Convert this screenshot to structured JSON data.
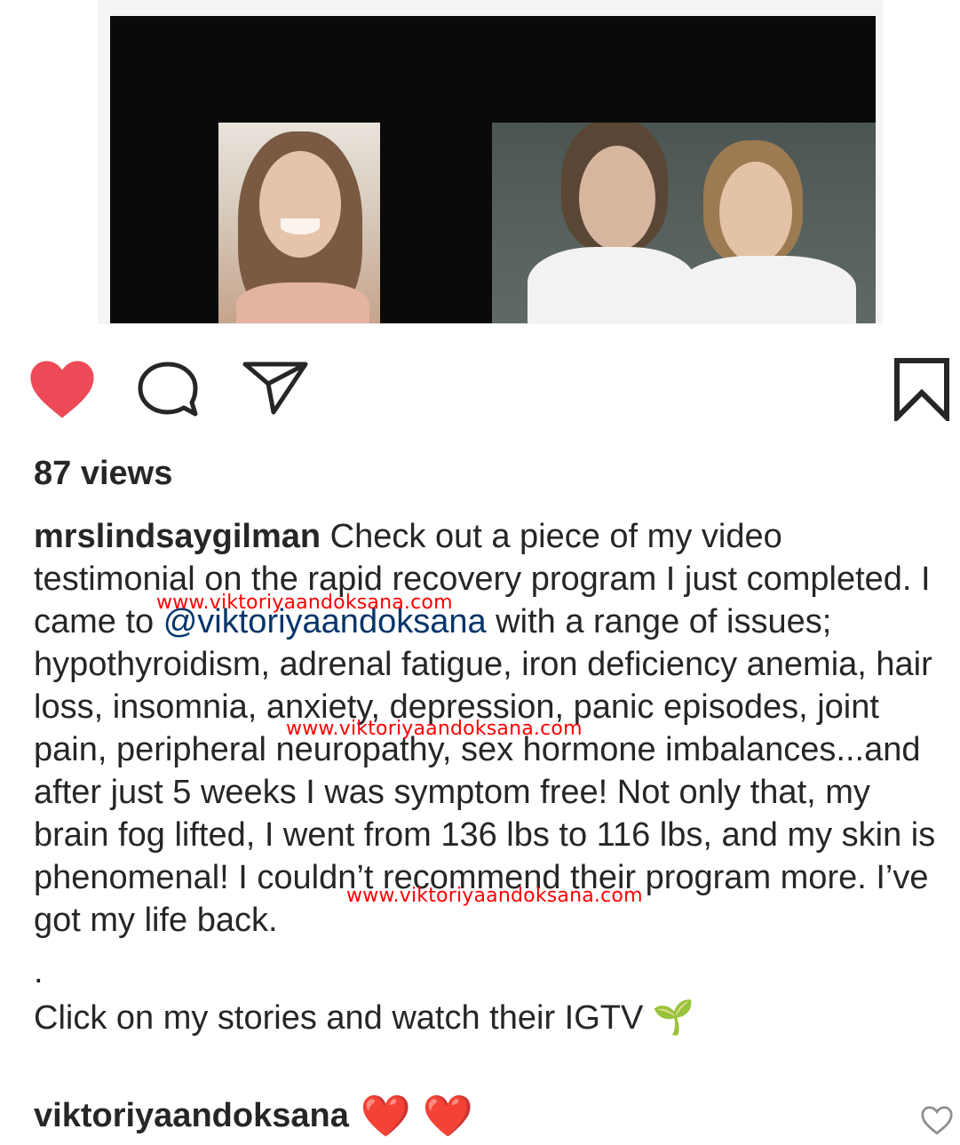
{
  "post": {
    "views": "87 views",
    "caption": {
      "username": "mrslindsaygilman",
      "text_part1": " Check out a piece of my video testimonial on the rapid recovery program I just completed.  I came to ",
      "mention": "@viktoriyaandoksana",
      "text_part2": " with a range of issues; hypothyroidism, adrenal fatigue, iron deficiency anemia, hair loss, insomnia, anxiety, depression, panic episodes, joint pain, peripheral neuropathy, sex hormone imbalances...and after just 5 weeks I was symptom free!  Not only that, my brain fog lifted, I went from 136 lbs to 116 lbs, and my skin is phenomenal!  I couldn’t recommend their program more.  I’ve got my life back.",
      "dot": ".",
      "cta": "Click on my stories and watch their IGTV 🌱"
    },
    "comment": {
      "username": "viktoriyaandoksana",
      "text": " ❤️ ❤️"
    }
  },
  "actions": {
    "like_icon": "heart-filled-icon",
    "comment_icon": "speech-bubble-icon",
    "share_icon": "paper-plane-icon",
    "save_icon": "bookmark-icon",
    "comment_like_icon": "heart-outline-icon"
  },
  "watermarks": [
    "www.viktoriyaandoksana.com",
    "www.viktoriyaandoksana.com",
    "www.viktoriyaandoksana.com"
  ],
  "colors": {
    "like": "#ed4956",
    "mention": "#003569",
    "watermark": "#ff0000"
  }
}
